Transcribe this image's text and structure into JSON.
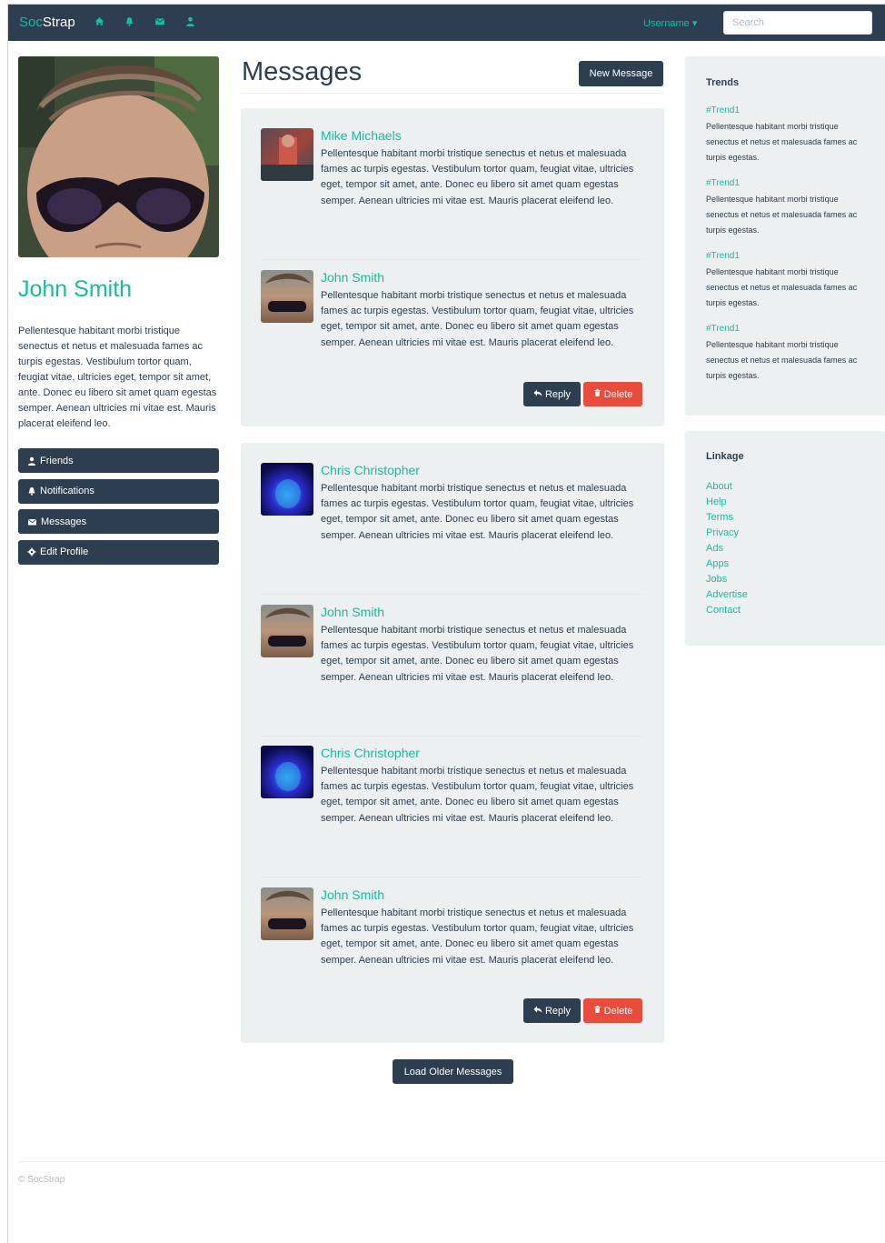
{
  "navbar": {
    "brand_prefix": "Soc",
    "brand_suffix": "Strap",
    "icons": [
      "home-icon",
      "bell-icon",
      "envelope-icon",
      "user-icon"
    ],
    "username": "Username",
    "search_placeholder": "Search"
  },
  "profile": {
    "name": "John Smith",
    "bio": "Pellentesque habitant morbi tristique senectus et netus et malesuada fames ac turpis egestas. Vestibulum tortor quam, feugiat vitae, ultricies eget, tempor sit amet, ante. Donec eu libero sit amet quam egestas semper. Aenean ultricies mi vitae est. Mauris placerat eleifend leo.",
    "nav": [
      {
        "label": "Friends",
        "icon": "user-icon"
      },
      {
        "label": "Notifications",
        "icon": "bell-icon"
      },
      {
        "label": "Messages",
        "icon": "envelope-icon"
      },
      {
        "label": "Edit Profile",
        "icon": "gear-icon"
      }
    ]
  },
  "main": {
    "title": "Messages",
    "new_message_label": "New Message",
    "reply_label": "Reply",
    "delete_label": "Delete",
    "load_older_label": "Load Older Messages",
    "threads": [
      {
        "messages": [
          {
            "author": "Mike Michaels",
            "body": "Pellentesque habitant morbi tristique senectus et netus et malesuada fames ac turpis egestas. Vestibulum tortor quam, feugiat vitae, ultricies eget, tempor sit amet, ante. Donec eu libero sit amet quam egestas semper. Aenean ultricies mi vitae est. Mauris placerat eleifend leo."
          },
          {
            "author": "John Smith",
            "body": "Pellentesque habitant morbi tristique senectus et netus et malesuada fames ac turpis egestas. Vestibulum tortor quam, feugiat vitae, ultricies eget, tempor sit amet, ante. Donec eu libero sit amet quam egestas semper. Aenean ultricies mi vitae est. Mauris placerat eleifend leo."
          }
        ]
      },
      {
        "messages": [
          {
            "author": "Chris Christopher",
            "body": "Pellentesque habitant morbi tristique senectus et netus et malesuada fames ac turpis egestas. Vestibulum tortor quam, feugiat vitae, ultricies eget, tempor sit amet, ante. Donec eu libero sit amet quam egestas semper. Aenean ultricies mi vitae est. Mauris placerat eleifend leo."
          },
          {
            "author": "John Smith",
            "body": "Pellentesque habitant morbi tristique senectus et netus et malesuada fames ac turpis egestas. Vestibulum tortor quam, feugiat vitae, ultricies eget, tempor sit amet, ante. Donec eu libero sit amet quam egestas semper. Aenean ultricies mi vitae est. Mauris placerat eleifend leo."
          },
          {
            "author": "Chris Christopher",
            "body": "Pellentesque habitant morbi tristique senectus et netus et malesuada fames ac turpis egestas. Vestibulum tortor quam, feugiat vitae, ultricies eget, tempor sit amet, ante. Donec eu libero sit amet quam egestas semper. Aenean ultricies mi vitae est. Mauris placerat eleifend leo."
          },
          {
            "author": "John Smith",
            "body": "Pellentesque habitant morbi tristique senectus et netus et malesuada fames ac turpis egestas. Vestibulum tortor quam, feugiat vitae, ultricies eget, tempor sit amet, ante. Donec eu libero sit amet quam egestas semper. Aenean ultricies mi vitae est. Mauris placerat eleifend leo."
          }
        ]
      }
    ]
  },
  "trends": {
    "title": "Trends",
    "items": [
      {
        "tag": "#Trend1",
        "text": "Pellentesque habitant morbi tristique senectus et netus et malesuada fames ac turpis egestas."
      },
      {
        "tag": "#Trend1",
        "text": "Pellentesque habitant morbi tristique senectus et netus et malesuada fames ac turpis egestas."
      },
      {
        "tag": "#Trend1",
        "text": "Pellentesque habitant morbi tristique senectus et netus et malesuada fames ac turpis egestas."
      },
      {
        "tag": "#Trend1",
        "text": "Pellentesque habitant morbi tristique senectus et netus et malesuada fames ac turpis egestas."
      }
    ]
  },
  "linkage": {
    "title": "Linkage",
    "links": [
      "About",
      "Help",
      "Terms",
      "Privacy",
      "Ads",
      "Apps",
      "Jobs",
      "Advertise",
      "Contact"
    ]
  },
  "footer": {
    "copyright": "© SocStrap"
  },
  "colors": {
    "navy": "#2c3e50",
    "accent": "#18bc9c",
    "danger": "#e74c3c",
    "panel": "#ecf0f1"
  }
}
